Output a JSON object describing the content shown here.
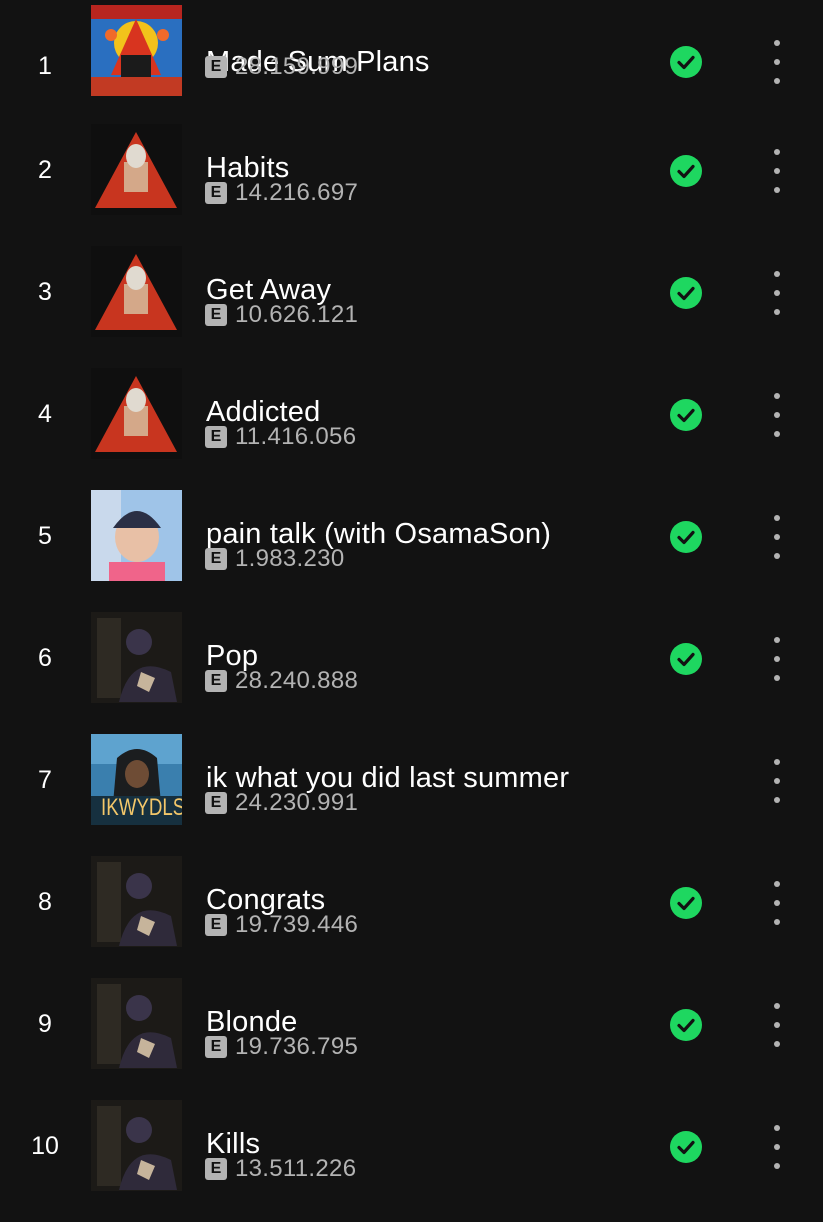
{
  "colors": {
    "background": "#121212",
    "primary_text": "#ffffff",
    "secondary_text": "#b3b3b3",
    "accent_green": "#1ed760"
  },
  "icons": {
    "downloaded": "check-circle-icon",
    "more": "more-vertical-icon",
    "explicit": "explicit-badge"
  },
  "tracks": [
    {
      "rank": "1",
      "title": "Made Sum Plans",
      "explicit_label": "E",
      "plays": "28.159.999",
      "downloaded": true
    },
    {
      "rank": "2",
      "title": "Habits",
      "explicit_label": "E",
      "plays": "14.216.697",
      "downloaded": true
    },
    {
      "rank": "3",
      "title": "Get Away",
      "explicit_label": "E",
      "plays": "10.626.121",
      "downloaded": true
    },
    {
      "rank": "4",
      "title": "Addicted",
      "explicit_label": "E",
      "plays": "11.416.056",
      "downloaded": true
    },
    {
      "rank": "5",
      "title": "pain talk (with OsamaSon)",
      "explicit_label": "E",
      "plays": "1.983.230",
      "downloaded": true
    },
    {
      "rank": "6",
      "title": "Pop",
      "explicit_label": "E",
      "plays": "28.240.888",
      "downloaded": true
    },
    {
      "rank": "7",
      "title": "ik what you did last summer",
      "explicit_label": "E",
      "plays": "24.230.991",
      "downloaded": false,
      "cover_text": "IKWYDLS"
    },
    {
      "rank": "8",
      "title": "Congrats",
      "explicit_label": "E",
      "plays": "19.739.446",
      "downloaded": true
    },
    {
      "rank": "9",
      "title": "Blonde",
      "explicit_label": "E",
      "plays": "19.736.795",
      "downloaded": true
    },
    {
      "rank": "10",
      "title": "Kills",
      "explicit_label": "E",
      "plays": "13.511.226",
      "downloaded": true
    }
  ]
}
